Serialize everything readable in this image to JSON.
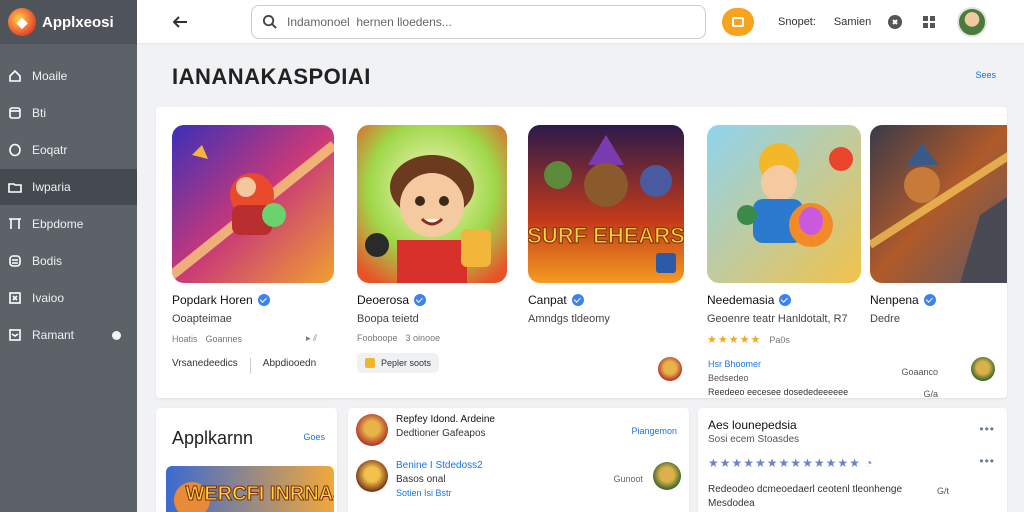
{
  "app": {
    "name": "Applxeosi",
    "logo_icon": "game-logo-icon"
  },
  "sidebar": {
    "items": [
      {
        "label": "Moaile",
        "icon": "home-icon"
      },
      {
        "label": "Bti",
        "icon": "document-icon"
      },
      {
        "label": "Eoqatr",
        "icon": "circle-icon"
      },
      {
        "label": "Iwparia",
        "icon": "folder-icon",
        "active": true
      },
      {
        "label": "Ebpdome",
        "icon": "bookmark-icon"
      },
      {
        "label": "Bodis",
        "icon": "stack-icon"
      },
      {
        "label": "Ivaioo",
        "icon": "grid-icon"
      },
      {
        "label": "Ramant",
        "icon": "message-icon",
        "dot": true
      }
    ]
  },
  "topbar": {
    "search_placeholder": "Indamonoel  hernen lloedens...",
    "link1": "Snopet:",
    "link2": "Samien"
  },
  "featured": {
    "title": "IANANAKASPOIAI",
    "more": "Sees",
    "cards": [
      {
        "title": "Popdark Horen",
        "sub": "Ooapteimae",
        "meta1": "Hoatis",
        "meta2": "Goannes",
        "action1": "Vrsanedeedics",
        "action2": "Abpdiooedn"
      },
      {
        "title": "Deoerosa",
        "sub": "Boopa teietd",
        "meta1": "Fooboope",
        "meta2": "3  oinooe",
        "chip": "Pepler soots"
      },
      {
        "title": "Canpat",
        "sub": "Amndgs tldeomy",
        "banner": "SURF EHEARS"
      },
      {
        "title": "Needemasia",
        "sub": "Geoenre teatr Hanldotalt, R7",
        "rating": "Pa0s",
        "link": "Hsr Bhoomer",
        "line1": "Bedsedeo",
        "line2": "Reedeeo eecesee dosededeeeeee",
        "side1": "Goaanco",
        "side2": "G/a"
      },
      {
        "title": "Nenpena",
        "sub": "Dedre"
      }
    ]
  },
  "bottom": {
    "p1": {
      "title": "Applkarnn",
      "more": "Goes",
      "banner": "WERCFI INRNAS"
    },
    "p2": {
      "rows": [
        {
          "t1": "Repfey Idond. Ardeine",
          "t2": "Dedtioner Gafeapos",
          "right": "Piangemon"
        },
        {
          "t1": "Benine I Stdedoss2",
          "t2": "Basos onal",
          "t3": "Sotien   Isi   Bstr",
          "right": "Gunoot"
        }
      ]
    },
    "p3": {
      "title": "Aes lounepedsia",
      "sub": "Sosi ecem  Stoasdes",
      "line1": "Redeodeo dcmeoedaerl ceotenl tleonhenge",
      "line2": "Mesdodea",
      "side": "G/t"
    }
  },
  "colors": {
    "accent": "#1a73e8",
    "sidebar": "#5d6269",
    "orange": "#f6a31e"
  }
}
